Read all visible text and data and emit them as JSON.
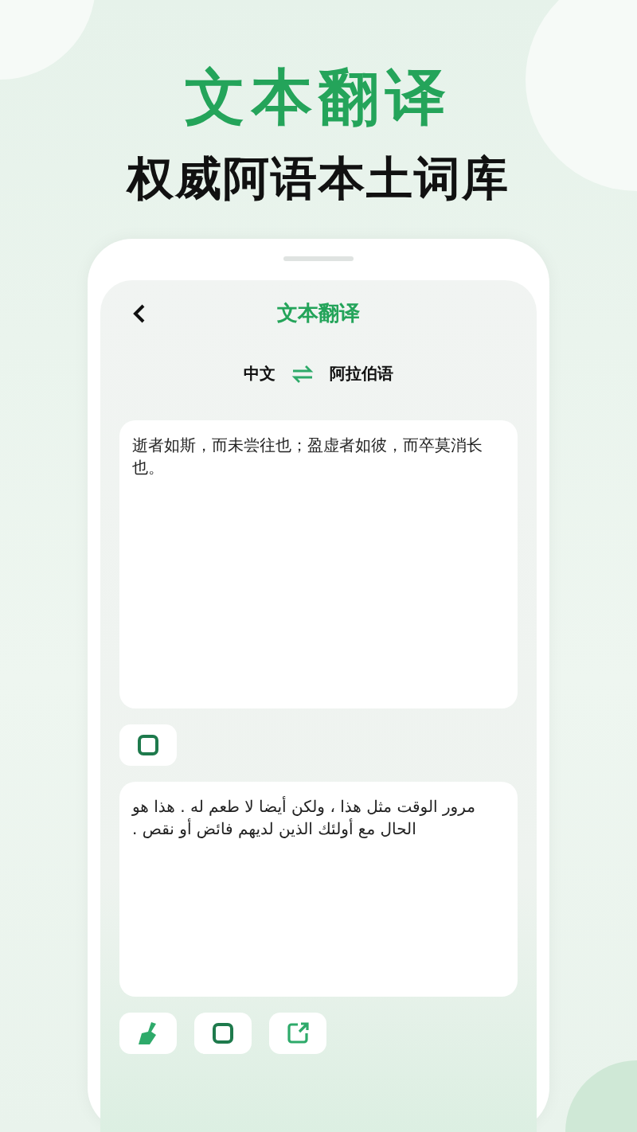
{
  "headline": "文本翻译",
  "subheadline": "权威阿语本土词库",
  "screen": {
    "title": "文本翻译",
    "source_language": "中文",
    "target_language": "阿拉伯语",
    "input_text": "逝者如斯，而未尝往也；盈虚者如彼，而卒莫消长也。",
    "output_text": "مرور الوقت مثل هذا ، ولكن أيضا لا طعم له . هذا هو الحال مع أولئك الذين لديهم فائض أو نقص ."
  }
}
